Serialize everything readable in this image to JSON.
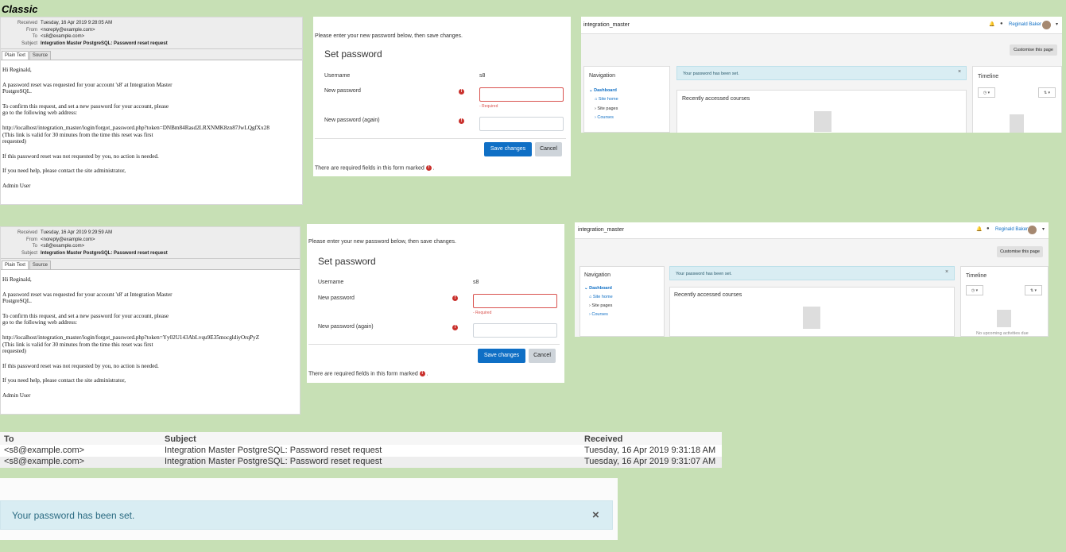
{
  "heading": "Classic",
  "email_top": {
    "received_label": "Received",
    "received": "Tuesday, 16 Apr 2019 9:28:05 AM",
    "from_label": "From",
    "from": "<noreply@example.com>",
    "to_label": "To",
    "to": "<s8@example.com>",
    "subject_label": "Subject",
    "subject": "Integration Master PostgreSQL: Password reset request",
    "tab_plain": "Plain Text",
    "tab_source": "Source",
    "greeting": "Hi Reginald,",
    "p1": "A password reset was requested for your account 's8' at Integration Master\nPostgreSQL.",
    "p2": "To confirm this request, and set a new password for your account, please\ngo to the following web address:",
    "p3": "http://localhost/integration_master/login/forgot_password.php?token=DNBm84Rasd2LRXNMK8zn87JwLQgfXx28\n(This link is valid for 30 minutes from the time this reset was first\nrequested)",
    "p4": "If this password reset was not requested by you, no action is needed.",
    "p5": "If you need help, please contact the site administrator,",
    "sig": "Admin User"
  },
  "email_bottom": {
    "received_label": "Received",
    "received": "Tuesday, 16 Apr 2019 9:29:59 AM",
    "from_label": "From",
    "from": "<noreply@example.com>",
    "to_label": "To",
    "to": "<s8@example.com>",
    "subject_label": "Subject",
    "subject": "Integration Master PostgreSQL: Password reset request",
    "tab_plain": "Plain Text",
    "tab_source": "Source",
    "greeting": "Hi Reginald,",
    "p1": "A password reset was requested for your account 's8' at Integration Master\nPostgreSQL.",
    "p2": "To confirm this request, and set a new password for your account, please\ngo to the following web address:",
    "p3": "http://localhost/integration_master/login/forgot_password.php?token=Yy02U143AbLvqu9E35mocgldiyOrqPyZ\n(This link is valid for 30 minutes from the time this reset was first\nrequested)",
    "p4": "If this password reset was not requested by you, no action is needed.",
    "p5": "If you need help, please contact the site administrator,",
    "sig": "Admin User"
  },
  "setpw": {
    "intro": "Please enter your new password below, then save changes.",
    "title": "Set password",
    "username_label": "Username",
    "username_value": "s8",
    "newpw_label": "New password",
    "required_msg": "- Required",
    "newpw2_label": "New password (again)",
    "save": "Save changes",
    "cancel": "Cancel",
    "footer": "There are required fields in this form marked",
    "footer_end": "."
  },
  "dash": {
    "site": "integration_master",
    "user": "Reginald Baker",
    "customise": "Customise this page",
    "nav_title": "Navigation",
    "nav_dashboard": "Dashboard",
    "nav_sitehome": "Site home",
    "nav_sitepages": "Site pages",
    "nav_courses": "Courses",
    "alert": "Your password has been set.",
    "recent": "Recently accessed courses",
    "timeline": "Timeline",
    "no_activities": "No upcoming activities due"
  },
  "table": {
    "headers": [
      "To",
      "Subject",
      "Received"
    ],
    "rows": [
      [
        "<s8@example.com>",
        "Integration Master PostgreSQL: Password reset request",
        "Tuesday, 16 Apr 2019 9:31:18 AM"
      ],
      [
        "<s8@example.com>",
        "Integration Master PostgreSQL: Password reset request",
        "Tuesday, 16 Apr 2019 9:31:07 AM"
      ]
    ]
  },
  "big_alert": {
    "message": "Your password has been set.",
    "close": "×"
  }
}
